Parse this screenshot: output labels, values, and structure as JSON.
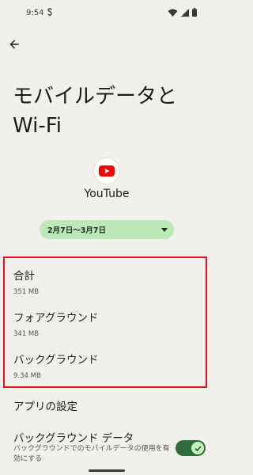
{
  "status_bar": {
    "time": "9:54",
    "sim_indicator": "S",
    "icons": [
      "wifi-icon",
      "signal-icon",
      "battery-icon"
    ]
  },
  "header": {
    "back_icon": "arrow-left-icon",
    "title": "モバイルデータと Wi-Fi"
  },
  "app": {
    "name": "YouTube",
    "icon": "youtube-icon",
    "brand_color": "#ff0000"
  },
  "date_range": {
    "selected": "2月7日〜3月7日",
    "chip_color": "#bde9b8"
  },
  "usage": [
    {
      "label": "合計",
      "value": "351 MB"
    },
    {
      "label": "フォアグラウンド",
      "value": "341 MB"
    },
    {
      "label": "バックグラウンド",
      "value": "9.34 MB"
    }
  ],
  "highlight_color": "#e0141e",
  "settings": {
    "section_title": "アプリの設定",
    "background_data": {
      "title": "バックグラウンド データ",
      "description": "バックグラウンドでのモバイルデータの使用を有効にする",
      "enabled": true,
      "toggle_color": "#2f6e3b"
    }
  }
}
